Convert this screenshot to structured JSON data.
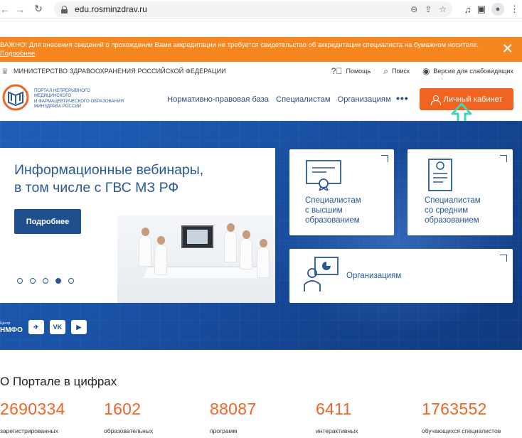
{
  "browser": {
    "url": "edu.rosminzdrav.ru"
  },
  "alert": {
    "text": "ВАЖНО! Для внесения сведений о прохождении Вами аккредитации не требуется свидетельство об аккредитации специалиста на бумажном носителе.",
    "link": "Подробнее"
  },
  "ministry": {
    "name": "МИНИСТЕРСТВО ЗДРАВООХРАНЕНИЯ РОССИЙСКОЙ ФЕДЕРАЦИИ",
    "help": "Помощь",
    "search": "Поиск",
    "accessibility": "Версия для слабовидящих"
  },
  "portal": {
    "name_lines": [
      "ПОРТАЛ НЕПРЕРЫВНОГО",
      "МЕДИЦИНСКОГО",
      "И ФАРМАЦЕВТИЧЕСКОГО ОБРАЗОВАНИЯ",
      "МИНЗДРАВА РОССИИ"
    ],
    "nav": [
      "Нормативно-правовая база",
      "Специалистам",
      "Организациям"
    ],
    "cabinet_label": "Личный кабинет"
  },
  "hero": {
    "title_lines": [
      "Информационные вебинары,",
      "в том числе с ГВС МЗ РФ"
    ],
    "button": "Подробнее",
    "dots_total": 5,
    "active_dot": 4,
    "cards": {
      "higher": [
        "Специалистам",
        "с высшим",
        "образованием"
      ],
      "middle": [
        "Специалистам",
        "со средним",
        "образованием"
      ],
      "orgs": "Организациям"
    },
    "social": {
      "nmfo_small": "Центр",
      "nmfo": "НМФО"
    }
  },
  "stats": {
    "title": "О Портале в цифрах",
    "items": [
      {
        "value": "2690334",
        "label": "зарегистрированных"
      },
      {
        "value": "1602",
        "label": "образовательных"
      },
      {
        "value": "88087",
        "label": "программ"
      },
      {
        "value": "6411",
        "label": "интерактивных"
      },
      {
        "value": "1763552",
        "label": "обучающихся специалистов"
      }
    ]
  },
  "colors": {
    "accent_orange": "#f06423",
    "alert_orange": "#f6861f",
    "brand_blue": "#2b5797",
    "annotation_arrow": "#3dd6b8"
  }
}
